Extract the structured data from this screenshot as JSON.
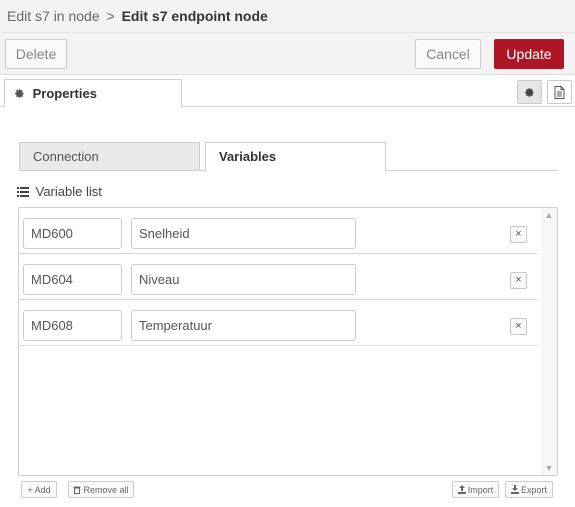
{
  "header": {
    "parent": "Edit s7 in node",
    "separator": ">",
    "current": "Edit s7 endpoint node"
  },
  "toolbar": {
    "delete_label": "Delete",
    "cancel_label": "Cancel",
    "update_label": "Update"
  },
  "properties_tab": {
    "label": "Properties",
    "icon": "gear-icon"
  },
  "sidebar_icons": [
    "gear-icon",
    "document-icon"
  ],
  "subtabs": [
    {
      "label": "Connection",
      "active": false
    },
    {
      "label": "Variables",
      "active": true
    }
  ],
  "variable_list": {
    "label": "Variable list",
    "rows": [
      {
        "address": "MD600",
        "name": "Snelheid"
      },
      {
        "address": "MD604",
        "name": "Niveau"
      },
      {
        "address": "MD608",
        "name": "Temperatuur"
      }
    ],
    "remove_label": "×"
  },
  "list_actions": {
    "add_label": "Add",
    "remove_all_label": "Remove all",
    "import_label": "Import",
    "export_label": "Export"
  },
  "colors": {
    "update_button": "#ad1625",
    "header_bg": "#f3f3f3"
  }
}
